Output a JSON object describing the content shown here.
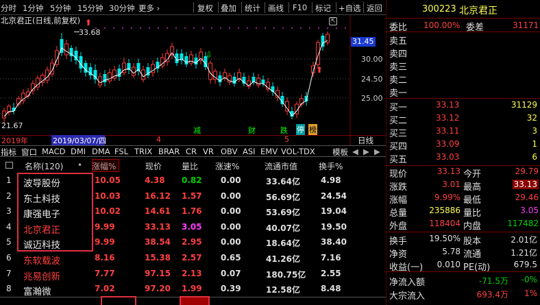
{
  "toolbar": {
    "periods": [
      "分时",
      "1分钟",
      "5分钟",
      "15分钟",
      "30分钟",
      "更多 ›"
    ],
    "buttons": [
      "复权",
      "叠加",
      "统计",
      "画线",
      "F10",
      "标记",
      "+自选",
      "返回"
    ]
  },
  "chart": {
    "title": "北京君正(日线,前复权)",
    "high_label": "33.68",
    "low_label": "21.67",
    "price_box": "31.45",
    "y_ticks": [
      "30.00",
      "24.50",
      "25.00"
    ],
    "year_label": "2019年",
    "date_highlight": "2019/03/07/四",
    "marks": [
      "4",
      "5"
    ],
    "right_label": "日线",
    "events": [
      "减",
      "财",
      "跌",
      "停",
      "榜"
    ],
    "colors": {
      "up": "#ff3c3c",
      "down": "#00e5e5",
      "ma": "#ffffff"
    }
  },
  "indicator_tabs": [
    "指标",
    "窗口",
    "MACD",
    "DMI",
    "DMA",
    "FSL",
    "TRIX",
    "BRAR",
    "CR",
    "VR",
    "OBV",
    "ASI",
    "EMV",
    "VOL-TDX",
    "模板"
  ],
  "table": {
    "headers": [
      "名称(120)",
      "•",
      "涨幅%",
      "现价",
      "量比",
      "涨速%",
      "流通市值",
      "换手%"
    ],
    "rows": [
      {
        "idx": "1",
        "name": "波导股份",
        "chg": "10.05",
        "price": "4.38",
        "vr": "0.82",
        "speed": "0.00",
        "cap": "33.64亿",
        "turn": "4.98"
      },
      {
        "idx": "2",
        "name": "东土科技",
        "chg": "10.03",
        "price": "16.12",
        "vr": "1.57",
        "speed": "0.00",
        "cap": "56.69亿",
        "turn": "24.54"
      },
      {
        "idx": "3",
        "name": "康强电子",
        "chg": "10.02",
        "price": "14.61",
        "vr": "1.76",
        "speed": "0.00",
        "cap": "53.69亿",
        "turn": "19.04"
      },
      {
        "idx": "4",
        "name": "北京君正",
        "chg": "9.99",
        "price": "33.13",
        "vr": "3.05",
        "speed": "0.00",
        "cap": "40.07亿",
        "turn": "19.50"
      },
      {
        "idx": "5",
        "name": "诚迈科技",
        "chg": "9.99",
        "price": "38.54",
        "vr": "2.95",
        "speed": "0.00",
        "cap": "18.64亿",
        "turn": "38.40"
      },
      {
        "idx": "6",
        "name": "东软载波",
        "chg": "8.16",
        "price": "15.38",
        "vr": "2.57",
        "speed": "0.65",
        "cap": "41.26亿",
        "turn": "7.16"
      },
      {
        "idx": "7",
        "name": "兆易创新",
        "chg": "7.77",
        "price": "97.15",
        "vr": "2.13",
        "speed": "0.07",
        "cap": "180.75亿",
        "turn": "2.55"
      },
      {
        "idx": "8",
        "name": "富瀚微",
        "chg": "7.02",
        "price": "97.20",
        "vr": "1.99",
        "speed": "0.39",
        "cap": "12.58亿",
        "turn": "8.48"
      }
    ]
  },
  "quote": {
    "code": "300223",
    "name": "北京君正",
    "weibi_label": "委比",
    "weibi": "100.00%",
    "weicha_label": "委差",
    "weicha": "31171",
    "sell": [
      {
        "label": "卖五"
      },
      {
        "label": "卖四"
      },
      {
        "label": "卖三"
      },
      {
        "label": "卖二"
      },
      {
        "label": "卖一"
      }
    ],
    "buy": [
      {
        "label": "买一",
        "price": "33.13",
        "vol": "31129"
      },
      {
        "label": "买二",
        "price": "33.12",
        "vol": "32"
      },
      {
        "label": "买三",
        "price": "33.11",
        "vol": "3"
      },
      {
        "label": "买四",
        "price": "33.09",
        "vol": "1"
      },
      {
        "label": "买五",
        "price": "33.03",
        "vol": "6"
      }
    ],
    "stats": [
      {
        "l1": "现价",
        "v1": "33.13",
        "l2": "今开",
        "v2": "29.79"
      },
      {
        "l1": "涨跌",
        "v1": "3.01",
        "l2": "最高",
        "v2": "33.13"
      },
      {
        "l1": "涨幅",
        "v1": "9.99%",
        "l2": "最低",
        "v2": "29.46"
      },
      {
        "l1": "总量",
        "v1": "235886",
        "l2": "量比",
        "v2": "3.05"
      },
      {
        "l1": "外盘",
        "v1": "118404",
        "l2": "内盘",
        "v2": "117482"
      }
    ],
    "stats2": [
      {
        "l1": "换手",
        "v1": "19.50%",
        "l2": "股本",
        "v2": "2.01亿"
      },
      {
        "l1": "净资",
        "v1": "5.78",
        "l2": "流通",
        "v2": "1.21亿"
      },
      {
        "l1": "收益(一)",
        "v1": "0.010",
        "l2": "PE(动)",
        "v2": "679.5"
      }
    ],
    "flow": [
      {
        "label": "净流入额",
        "v1": "-71.5万",
        "v2": "-0%"
      },
      {
        "label": "大宗流入",
        "v1": "693.4万",
        "v2": "1%"
      }
    ]
  }
}
